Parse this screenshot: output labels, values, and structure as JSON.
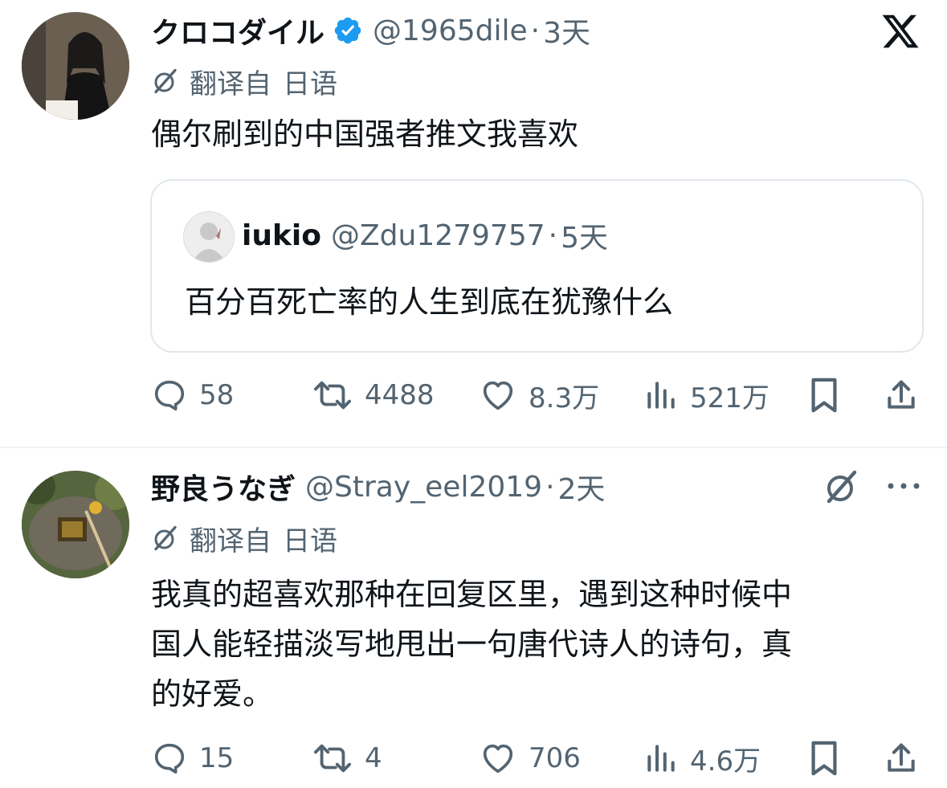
{
  "tweets": [
    {
      "author": {
        "name": "クロコダイル",
        "handle": "@1965dile",
        "verified": true
      },
      "separator": "·",
      "time": "3天",
      "translated": {
        "label": "翻译自",
        "language": "日语"
      },
      "text": "偶尔刷到的中国强者推文我喜欢",
      "quote": {
        "author": {
          "name": "iukio",
          "handle": "@Zdu1279757"
        },
        "separator": "·",
        "time": "5天",
        "text": "百分百死亡率的人生到底在犹豫什么"
      },
      "actions": {
        "replies": "58",
        "retweets": "4488",
        "likes": "8.3万",
        "views": "521万"
      }
    },
    {
      "author": {
        "name": "野良うなぎ",
        "handle": "@Stray_eel2019"
      },
      "separator": "·",
      "time": "2天",
      "translated": {
        "label": "翻译自",
        "language": "日语"
      },
      "text_lines": [
        "我真的超喜欢那种在回复区里，遇到这种时候中",
        "国人能轻描淡写地甩出一句唐代诗人的诗句，真",
        "的好爱。"
      ],
      "actions": {
        "replies": "15",
        "retweets": "4",
        "likes": "706",
        "views": "4.6万"
      }
    }
  ],
  "icons": {
    "brand": "x-logo-icon",
    "verified": "verified-badge-icon",
    "translate": "grok-slash-icon",
    "more": "more-dots-icon"
  },
  "colors": {
    "text": "#0f1419",
    "secondary": "#536471",
    "verified": "#1d9bf0",
    "border": "#e1e8ed"
  }
}
